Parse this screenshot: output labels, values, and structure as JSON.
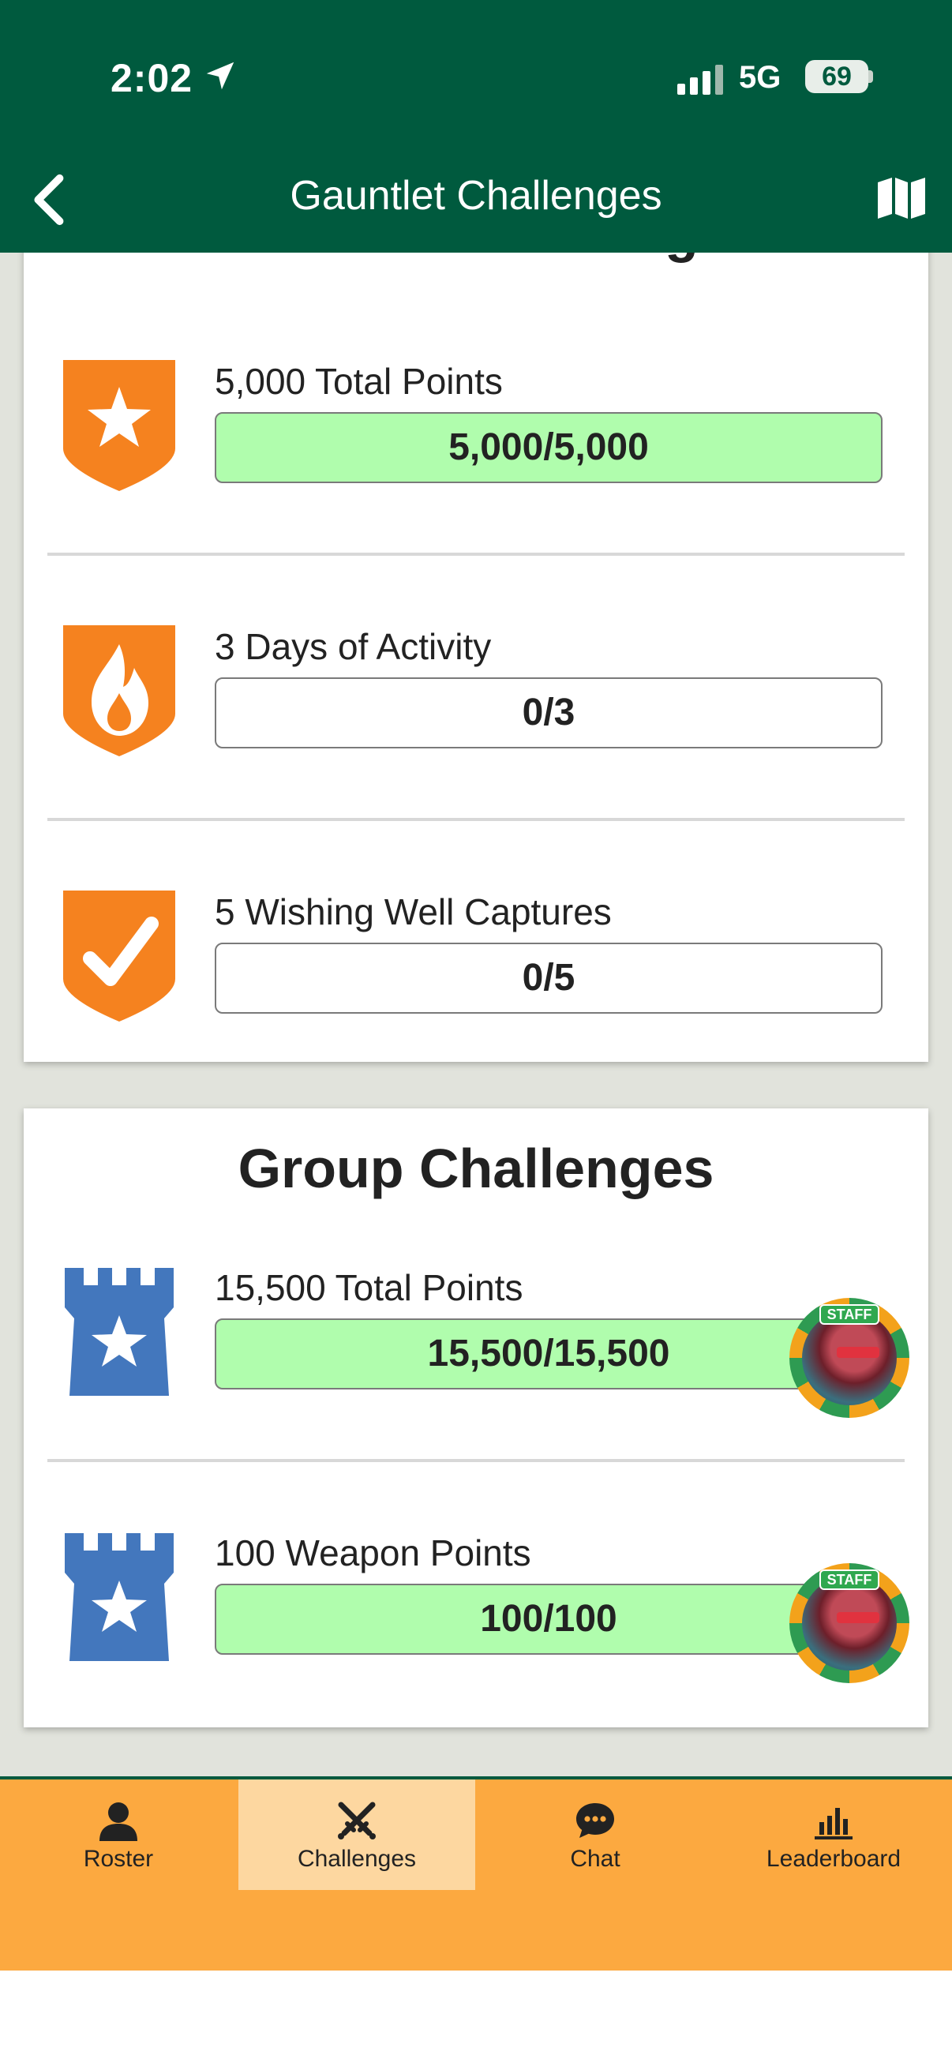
{
  "status_bar": {
    "time": "2:02",
    "network": "5G",
    "battery": "69"
  },
  "header": {
    "title": "Gauntlet Challenges",
    "back_icon": "chevron-left-icon",
    "map_icon": "map-icon"
  },
  "individual": {
    "title": "Individual Challenges",
    "items": [
      {
        "label": "5,000 Total Points",
        "progress": "5,000/5,000",
        "complete": true,
        "icon": "star-shield-icon"
      },
      {
        "label": "3 Days of Activity",
        "progress": "0/3",
        "complete": false,
        "icon": "flame-shield-icon"
      },
      {
        "label": "5 Wishing Well Captures",
        "progress": "0/5",
        "complete": false,
        "icon": "check-shield-icon"
      }
    ]
  },
  "group": {
    "title": "Group Challenges",
    "items": [
      {
        "label": "15,500 Total Points",
        "progress": "15,500/15,500",
        "complete": true,
        "icon": "castle-star-icon",
        "avatar_badge": "STAFF"
      },
      {
        "label": "100 Weapon Points",
        "progress": "100/100",
        "complete": true,
        "icon": "castle-star-icon",
        "avatar_badge": "STAFF"
      }
    ]
  },
  "tabs": [
    {
      "label": "Roster",
      "icon": "person-icon",
      "active": false
    },
    {
      "label": "Challenges",
      "icon": "crossed-swords-icon",
      "active": true
    },
    {
      "label": "Chat",
      "icon": "chat-bubble-icon",
      "active": false
    },
    {
      "label": "Leaderboard",
      "icon": "bar-chart-icon",
      "active": false
    }
  ],
  "colors": {
    "header_bg": "#005a3e",
    "complete_bar": "#b0fdad",
    "individual_icon": "#f5821f",
    "group_icon": "#4377bd",
    "tabbar_bg": "#fca940",
    "tab_active_bg": "#fdd7a0"
  }
}
